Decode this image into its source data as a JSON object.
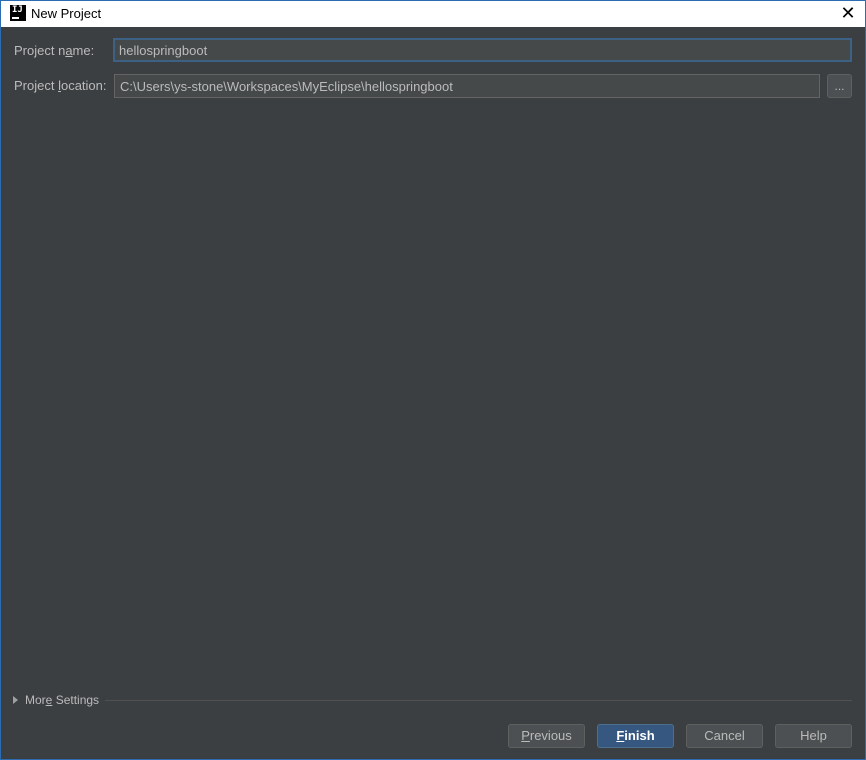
{
  "window": {
    "title": "New Project",
    "close_glyph": "✕",
    "icon_glyph": "IJ"
  },
  "form": {
    "project_name_label_pre": "Project n",
    "project_name_label_mn": "a",
    "project_name_label_post": "me:",
    "project_name_value": "hellospringboot",
    "project_location_label_pre": "Project ",
    "project_location_label_mn": "l",
    "project_location_label_post": "ocation:",
    "project_location_value": "C:\\Users\\ys-stone\\Workspaces\\MyEclipse\\hellospringboot",
    "browse_label": "..."
  },
  "more_settings": {
    "label_pre": "Mor",
    "label_mn": "e",
    "label_post": " Settings"
  },
  "buttons": {
    "previous_mn": "P",
    "previous_rest": "revious",
    "finish_mn": "F",
    "finish_rest": "inish",
    "cancel": "Cancel",
    "help": "Help"
  }
}
